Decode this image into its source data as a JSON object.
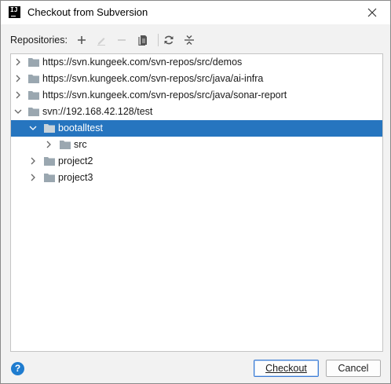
{
  "dialog": {
    "title": "Checkout from Subversion",
    "app_icon_text": "IJ"
  },
  "toolbar": {
    "label": "Repositories:",
    "buttons": [
      {
        "icon": "add-icon",
        "enabled": true
      },
      {
        "icon": "edit-icon",
        "enabled": false
      },
      {
        "icon": "remove-icon",
        "enabled": false
      },
      {
        "icon": "browse-changes-icon",
        "enabled": true
      },
      {
        "icon": "refresh-icon",
        "enabled": true
      },
      {
        "icon": "collapse-all-icon",
        "enabled": true
      }
    ]
  },
  "tree": {
    "rows": [
      {
        "label": "https://svn.kungeek.com/svn-repos/src/demos",
        "level": 0,
        "expanded": false,
        "selected": false
      },
      {
        "label": "https://svn.kungeek.com/svn-repos/src/java/ai-infra",
        "level": 0,
        "expanded": false,
        "selected": false
      },
      {
        "label": "https://svn.kungeek.com/svn-repos/src/java/sonar-report",
        "level": 0,
        "expanded": false,
        "selected": false
      },
      {
        "label": "svn://192.168.42.128/test",
        "level": 0,
        "expanded": true,
        "selected": false
      },
      {
        "label": "bootalltest",
        "level": 1,
        "expanded": true,
        "selected": true
      },
      {
        "label": "src",
        "level": 2,
        "expanded": false,
        "selected": false
      },
      {
        "label": "project2",
        "level": 1,
        "expanded": false,
        "selected": false
      },
      {
        "label": "project3",
        "level": 1,
        "expanded": false,
        "selected": false
      }
    ]
  },
  "footer": {
    "help_label": "?",
    "checkout_label": "Checkout",
    "cancel_label": "Cancel"
  },
  "colors": {
    "selection": "#2675bf",
    "folder": "#9aa7b0",
    "accent": "#1f7ccf"
  }
}
